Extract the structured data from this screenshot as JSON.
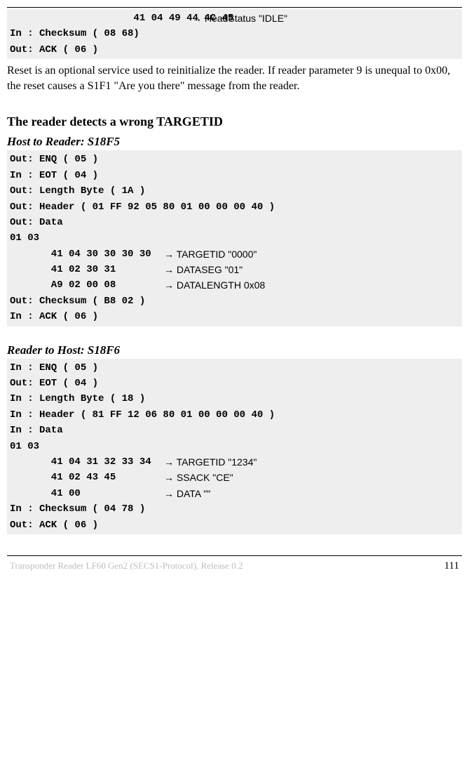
{
  "block1": {
    "row0_col1": "                     41 04 49 44 4C 45",
    "row0_col2": "→ HeadStatus \"IDLE\"",
    "row1": "In : Checksum ( 08 68)",
    "row2": "Out: ACK ( 06 )"
  },
  "paragraph1": "Reset is an optional service used to reinitialize the reader. If reader parameter 9 is unequal to 0x00, the reset causes a S1F1 \"Are you there\" message from the reader.",
  "section_title": "The reader detects a wrong TARGETID",
  "host_to_reader": "Host to Reader: S18F5",
  "block2": {
    "r0": "Out: ENQ ( 05 )",
    "r1": "In : EOT ( 04 )",
    "r2": "Out: Length Byte ( 1A )",
    "r3": "Out: Header ( 01 FF 92 05 80 01 00 00 00 40 )",
    "r4": "Out: Data",
    "r5": "     01 03",
    "r6_c1": "       41 04 30 30 30 30",
    "r6_c2": "→ TARGETID \"0000\"",
    "r7_c1": "       41 02 30 31",
    "r7_c2": "→ DATASEG  \"01\"",
    "r8_c1": "       A9 02 00 08",
    "r8_c2": "→ DATALENGTH  0x08",
    "r9": "Out: Checksum ( B8 02 )",
    "r10": "In : ACK ( 06 )"
  },
  "reader_to_host": "Reader to Host: S18F6",
  "block3": {
    "r0": "In : ENQ ( 05 )",
    "r1": "Out: EOT ( 04 )",
    "r2": "In : Length Byte ( 18 )",
    "r3": "In : Header ( 81 FF 12 06 80 01 00 00 00 40 )",
    "r4": "In : Data",
    "r5": "     01 03",
    "r6_c1": "       41 04 31 32 33 34",
    "r6_c2": "→ TARGETID \"1234\"",
    "r7_c1": "       41 02 43 45",
    "r7_c2": "→ SSACK \"CE\"",
    "r8_c1": "       41 00",
    "r8_c2": "→ DATA  \"\"",
    "r9": "In : Checksum ( 04 78 )",
    "r10": "Out: ACK ( 06 )"
  },
  "footer_left": "Transponder Reader LF60 Gen2 (SECS1-Protocol), Release 0.2",
  "footer_right": "111"
}
